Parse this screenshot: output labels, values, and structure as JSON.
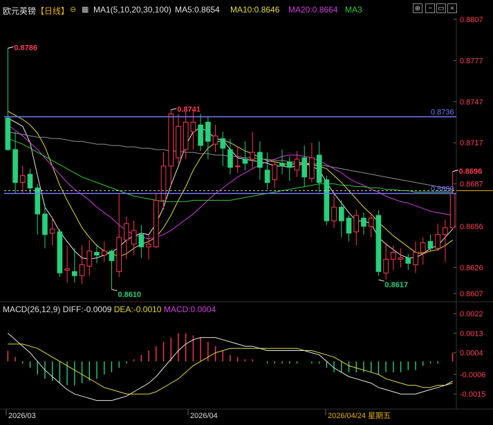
{
  "header": {
    "instrument": "欧元英镑",
    "period": "【日线】",
    "ma_group": "MA1(5,10,20,30,100)",
    "ma5": "MA5:0.8654",
    "ma10": "MA10:0.8646",
    "ma20": "MA20:0.8664",
    "ma3": "MA3",
    "macd_title": "MACD(26,12,9)",
    "diff": "DIFF:-0.0009",
    "dea": "DEA:-0.0010",
    "macd": "MACD:0.0004"
  },
  "colors": {
    "up": "#ff3b4e",
    "down": "#27d07a",
    "ma5": "#e8e8e8",
    "ma10": "#e8dc3c",
    "ma20": "#d040e0",
    "ma30": "#33cc33",
    "ma100": "#909090",
    "hline": "#7878ff",
    "dea": "#e8dc3c",
    "diff": "#e8e8e8",
    "axis_text": "#ff4455"
  },
  "chart_data": [
    {
      "type": "candlestick",
      "title": "欧元英镑【日线】",
      "ylim": [
        0.8607,
        0.8807
      ],
      "y_ticks": [
        "0.8807",
        "0.8777",
        "0.8747",
        "0.8717",
        "0.8687",
        "0.8656",
        "0.8626",
        "0.8607"
      ],
      "x_labels": [
        "2026/03",
        "2026/04",
        "2026/04/24 星期五"
      ],
      "candles": [
        [
          0.8735,
          0.8712,
          0.8786,
          0.8711
        ],
        [
          0.8712,
          0.8688,
          0.8725,
          0.868
        ],
        [
          0.8688,
          0.8693,
          0.87,
          0.868
        ],
        [
          0.8694,
          0.8684,
          0.8698,
          0.868
        ],
        [
          0.8684,
          0.8665,
          0.8687,
          0.865
        ],
        [
          0.8665,
          0.865,
          0.8672,
          0.864
        ],
        [
          0.8651,
          0.8654,
          0.8663,
          0.8642
        ],
        [
          0.8652,
          0.8622,
          0.8654,
          0.8619
        ],
        [
          0.8624,
          0.8625,
          0.8642,
          0.8615
        ],
        [
          0.8623,
          0.862,
          0.864,
          0.8615
        ],
        [
          0.862,
          0.8628,
          0.8642,
          0.8614
        ],
        [
          0.8627,
          0.8638,
          0.8646,
          0.862
        ],
        [
          0.8637,
          0.8635,
          0.8643,
          0.8629
        ],
        [
          0.8635,
          0.8638,
          0.8645,
          0.863
        ],
        [
          0.8638,
          0.8631,
          0.8639,
          0.861
        ],
        [
          0.8623,
          0.8648,
          0.868,
          0.8619
        ],
        [
          0.8646,
          0.8658,
          0.8663,
          0.8632
        ],
        [
          0.8643,
          0.8653,
          0.866,
          0.8635
        ],
        [
          0.865,
          0.8641,
          0.8657,
          0.8633
        ],
        [
          0.8641,
          0.8643,
          0.865,
          0.8632
        ],
        [
          0.8641,
          0.8675,
          0.868,
          0.864
        ],
        [
          0.8675,
          0.87,
          0.871,
          0.8668
        ],
        [
          0.87,
          0.8738,
          0.8741,
          0.8685
        ],
        [
          0.8706,
          0.8729,
          0.8738,
          0.8702
        ],
        [
          0.8712,
          0.8732,
          0.874,
          0.8705
        ],
        [
          0.8725,
          0.8732,
          0.8741,
          0.8712
        ],
        [
          0.873,
          0.8715,
          0.8738,
          0.8711
        ],
        [
          0.8732,
          0.8718,
          0.8736,
          0.8705
        ],
        [
          0.8716,
          0.8722,
          0.873,
          0.871
        ],
        [
          0.872,
          0.8713,
          0.8725,
          0.87
        ],
        [
          0.8712,
          0.8699,
          0.872,
          0.8694
        ],
        [
          0.87,
          0.87,
          0.8714,
          0.8695
        ],
        [
          0.8705,
          0.8702,
          0.8718,
          0.8697
        ],
        [
          0.8705,
          0.871,
          0.8725,
          0.8698
        ],
        [
          0.871,
          0.8699,
          0.8718,
          0.869
        ],
        [
          0.8697,
          0.8688,
          0.871,
          0.8683
        ],
        [
          0.869,
          0.8701,
          0.8703,
          0.8684
        ],
        [
          0.8702,
          0.87,
          0.8712,
          0.8694
        ],
        [
          0.8703,
          0.8699,
          0.8707,
          0.8689
        ],
        [
          0.8697,
          0.8705,
          0.8711,
          0.8692
        ],
        [
          0.8706,
          0.8692,
          0.8715,
          0.8685
        ],
        [
          0.8691,
          0.8706,
          0.8717,
          0.8688
        ],
        [
          0.8708,
          0.8688,
          0.8718,
          0.8681
        ],
        [
          0.869,
          0.866,
          0.8693,
          0.8657
        ],
        [
          0.866,
          0.867,
          0.868,
          0.8655
        ],
        [
          0.867,
          0.866,
          0.8675,
          0.8648
        ],
        [
          0.8662,
          0.8651,
          0.8664,
          0.8645
        ],
        [
          0.8652,
          0.8664,
          0.8668,
          0.8642
        ],
        [
          0.8662,
          0.8656,
          0.8666,
          0.865
        ],
        [
          0.8656,
          0.8662,
          0.8666,
          0.8648
        ],
        [
          0.8664,
          0.8623,
          0.8668,
          0.862
        ],
        [
          0.8622,
          0.8632,
          0.8644,
          0.8617
        ],
        [
          0.8632,
          0.8637,
          0.8642,
          0.8624
        ],
        [
          0.8632,
          0.8633,
          0.864,
          0.8626
        ],
        [
          0.8633,
          0.8629,
          0.8636,
          0.8624
        ],
        [
          0.8628,
          0.8637,
          0.8645,
          0.8622
        ],
        [
          0.8637,
          0.8644,
          0.8648,
          0.8628
        ],
        [
          0.8645,
          0.864,
          0.865,
          0.8638
        ],
        [
          0.864,
          0.865,
          0.8658,
          0.8638
        ],
        [
          0.865,
          0.8655,
          0.8661,
          0.863
        ],
        [
          0.8655,
          0.868,
          0.8696,
          0.8654
        ]
      ],
      "ma_series": [
        {
          "name": "MA5",
          "values": [
            0.8735,
            0.8732,
            0.8729,
            0.8717,
            0.8693,
            0.867,
            0.8662,
            0.8652,
            0.8645,
            0.8638,
            0.8633,
            0.8632,
            0.8633,
            0.8635,
            0.8637,
            0.8641,
            0.8646,
            0.8649,
            0.8651,
            0.865,
            0.8658,
            0.867,
            0.8686,
            0.87,
            0.8715,
            0.8725,
            0.8728,
            0.8725,
            0.872,
            0.8719,
            0.8712,
            0.8706,
            0.8705,
            0.8704,
            0.8703,
            0.8702,
            0.87,
            0.87,
            0.8699,
            0.87,
            0.8702,
            0.87,
            0.8697,
            0.8688,
            0.868,
            0.8673,
            0.8666,
            0.866,
            0.866,
            0.8658,
            0.8648,
            0.8643,
            0.8639,
            0.8635,
            0.8633,
            0.8633,
            0.8636,
            0.864,
            0.8642,
            0.8648,
            0.8654
          ]
        },
        {
          "name": "MA10",
          "values": [
            0.874,
            0.8737,
            0.8734,
            0.873,
            0.8724,
            0.8714,
            0.87,
            0.8686,
            0.8675,
            0.8665,
            0.8655,
            0.8648,
            0.8642,
            0.8638,
            0.8636,
            0.8634,
            0.8636,
            0.864,
            0.8643,
            0.8645,
            0.8648,
            0.8655,
            0.8664,
            0.8675,
            0.8685,
            0.8697,
            0.8706,
            0.8713,
            0.8717,
            0.8719,
            0.8717,
            0.8714,
            0.8711,
            0.8709,
            0.8706,
            0.8704,
            0.8703,
            0.8702,
            0.8701,
            0.8702,
            0.8702,
            0.8701,
            0.87,
            0.8698,
            0.8693,
            0.8688,
            0.8682,
            0.8676,
            0.867,
            0.8665,
            0.8659,
            0.8654,
            0.8649,
            0.8645,
            0.8641,
            0.8637,
            0.8636,
            0.8638,
            0.8639,
            0.8642,
            0.8646
          ]
        },
        {
          "name": "MA20",
          "values": [
            0.873,
            0.8726,
            0.8722,
            0.8717,
            0.8712,
            0.8706,
            0.87,
            0.8694,
            0.8688,
            0.8683,
            0.8679,
            0.8675,
            0.867,
            0.8666,
            0.8662,
            0.8657,
            0.8653,
            0.865,
            0.8648,
            0.8647,
            0.8648,
            0.865,
            0.8653,
            0.8657,
            0.8661,
            0.8665,
            0.867,
            0.8675,
            0.868,
            0.8684,
            0.8688,
            0.8692,
            0.8695,
            0.8698,
            0.8701,
            0.8703,
            0.8705,
            0.8707,
            0.8708,
            0.8708,
            0.8707,
            0.8706,
            0.8704,
            0.8701,
            0.8698,
            0.8695,
            0.8691,
            0.8688,
            0.8686,
            0.8683,
            0.8681,
            0.8678,
            0.8676,
            0.8674,
            0.8673,
            0.8671,
            0.8669,
            0.8667,
            0.8666,
            0.8665,
            0.8664
          ]
        },
        {
          "name": "MA30",
          "values": [
            0.872,
            0.8718,
            0.8716,
            0.8713,
            0.871,
            0.8707,
            0.8704,
            0.8701,
            0.8698,
            0.8695,
            0.8692,
            0.869,
            0.8688,
            0.8686,
            0.8684,
            0.8682,
            0.868,
            0.8678,
            0.8677,
            0.8676,
            0.8675,
            0.8674,
            0.8674,
            0.8674,
            0.8674,
            0.8675,
            0.8675,
            0.8675,
            0.8675,
            0.8675,
            0.8675,
            0.8676,
            0.8677,
            0.8678,
            0.8679,
            0.868,
            0.8681,
            0.8682,
            0.8683,
            0.8684,
            0.8685,
            0.8686,
            0.8687,
            0.8687,
            0.8687,
            0.8686,
            0.8686,
            0.8685,
            0.8685,
            0.8684,
            0.8684,
            0.8683,
            0.8683,
            0.8682,
            0.8682,
            0.8681,
            0.8681,
            0.8681,
            0.8681,
            0.8681,
            0.8681
          ]
        },
        {
          "name": "MA100",
          "values": [
            0.8725,
            0.8724,
            0.8723,
            0.8722,
            0.8721,
            0.8721,
            0.872,
            0.872,
            0.8719,
            0.8718,
            0.8718,
            0.8717,
            0.8716,
            0.8716,
            0.8715,
            0.8715,
            0.8714,
            0.8714,
            0.8713,
            0.8713,
            0.8712,
            0.8712,
            0.8711,
            0.8711,
            0.871,
            0.871,
            0.8709,
            0.8709,
            0.8708,
            0.8708,
            0.8707,
            0.8707,
            0.8706,
            0.8706,
            0.8705,
            0.8705,
            0.8704,
            0.8704,
            0.8703,
            0.8703,
            0.8702,
            0.8702,
            0.8701,
            0.87,
            0.8699,
            0.8698,
            0.8697,
            0.8696,
            0.8695,
            0.8694,
            0.8693,
            0.8692,
            0.8691,
            0.869,
            0.8689,
            0.8688,
            0.8687,
            0.8686,
            0.8685,
            0.8684,
            0.8683
          ]
        }
      ],
      "hlines": [
        {
          "value": 0.8736,
          "label": "0.8736"
        },
        {
          "value": 0.868,
          "label": "0.8680"
        }
      ],
      "dashed_level": 0.8682,
      "annotations": [
        {
          "index": 0,
          "value": 0.8786,
          "label": "0.8786",
          "side": "high"
        },
        {
          "index": 22,
          "value": 0.8741,
          "label": "0.8741",
          "side": "high"
        },
        {
          "index": 14,
          "value": 0.861,
          "label": "0.8610",
          "side": "low"
        },
        {
          "index": 50,
          "value": 0.8617,
          "label": "0.8617",
          "side": "low"
        },
        {
          "index": 60,
          "value": 0.8696,
          "label": "0.8696",
          "side": "high"
        }
      ]
    },
    {
      "type": "macd",
      "title": "MACD(26,12,9)",
      "ylim": [
        -0.0021,
        0.0023
      ],
      "y_ticks": [
        "0.0022",
        "0.0013",
        "0.0004",
        "-0.0006",
        "-0.0015"
      ],
      "diff": [
        0.0013,
        0.001,
        0.0007,
        0.0004,
        0.0,
        -0.0004,
        -0.0007,
        -0.001,
        -0.0013,
        -0.0015,
        -0.0016,
        -0.0017,
        -0.0018,
        -0.0018,
        -0.0018,
        -0.0017,
        -0.0016,
        -0.0014,
        -0.0012,
        -0.001,
        -0.0007,
        -0.0003,
        0.0001,
        0.0005,
        0.0008,
        0.001,
        0.0011,
        0.0011,
        0.0011,
        0.001,
        0.0009,
        0.0008,
        0.0007,
        0.0007,
        0.0006,
        0.0005,
        0.0005,
        0.0005,
        0.0005,
        0.0005,
        0.0005,
        0.0004,
        0.0003,
        0.0,
        -0.0003,
        -0.0005,
        -0.0007,
        -0.0008,
        -0.0009,
        -0.001,
        -0.0012,
        -0.0013,
        -0.0014,
        -0.0015,
        -0.0015,
        -0.0015,
        -0.0014,
        -0.0013,
        -0.0012,
        -0.0011,
        -0.0009
      ],
      "dea": [
        0.0008,
        0.0008,
        0.0008,
        0.0007,
        0.0006,
        0.0004,
        0.0002,
        0.0,
        -0.0002,
        -0.0004,
        -0.0006,
        -0.0008,
        -0.001,
        -0.0012,
        -0.0013,
        -0.0014,
        -0.0015,
        -0.0015,
        -0.0015,
        -0.0015,
        -0.0014,
        -0.0012,
        -0.001,
        -0.0008,
        -0.0005,
        -0.0002,
        0.0,
        0.0002,
        0.0004,
        0.0005,
        0.0006,
        0.0006,
        0.0006,
        0.0006,
        0.0006,
        0.0006,
        0.0006,
        0.0006,
        0.0006,
        0.0006,
        0.0005,
        0.0005,
        0.0004,
        0.0003,
        0.0002,
        0.0,
        -0.0002,
        -0.0003,
        -0.0004,
        -0.0005,
        -0.0006,
        -0.0008,
        -0.0009,
        -0.001,
        -0.0011,
        -0.0011,
        -0.0012,
        -0.0012,
        -0.0011,
        -0.0011,
        -0.001
      ],
      "hist": [
        0.0005,
        0.0002,
        -0.0001,
        -0.0003,
        -0.0006,
        -0.0008,
        -0.0009,
        -0.001,
        -0.0011,
        -0.0011,
        -0.001,
        -0.0009,
        -0.0008,
        -0.0006,
        -0.0005,
        -0.0003,
        -0.0001,
        0.0001,
        0.0003,
        0.0005,
        0.0007,
        0.0009,
        0.0011,
        0.0013,
        0.0013,
        0.0012,
        0.0011,
        0.0009,
        0.0007,
        0.0005,
        0.0003,
        0.0002,
        0.0001,
        0.0001,
        0.0,
        -0.0001,
        -0.0001,
        -0.0001,
        -0.0001,
        -0.0001,
        0.0,
        -0.0001,
        -0.0001,
        -0.0003,
        -0.0005,
        -0.0005,
        -0.0005,
        -0.0005,
        -0.0005,
        -0.0005,
        -0.0006,
        -0.0005,
        -0.0005,
        -0.0005,
        -0.0004,
        -0.0004,
        -0.0002,
        -0.0001,
        -0.0001,
        0.0,
        0.0004
      ]
    }
  ]
}
